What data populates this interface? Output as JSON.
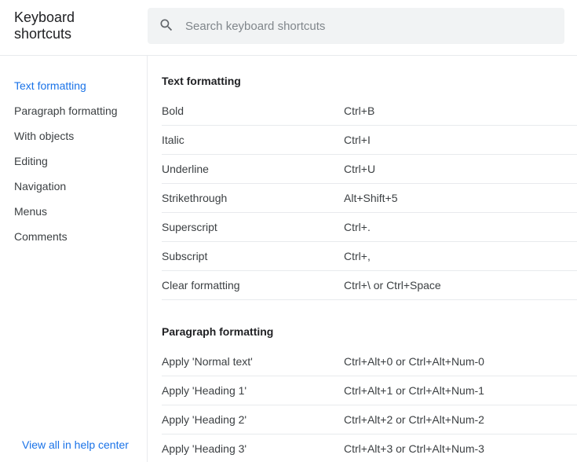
{
  "title": "Keyboard shortcuts",
  "search": {
    "placeholder": "Search keyboard shortcuts"
  },
  "sidebar": {
    "items": [
      {
        "label": "Text formatting",
        "active": true
      },
      {
        "label": "Paragraph formatting",
        "active": false
      },
      {
        "label": "With objects",
        "active": false
      },
      {
        "label": "Editing",
        "active": false
      },
      {
        "label": "Navigation",
        "active": false
      },
      {
        "label": "Menus",
        "active": false
      },
      {
        "label": "Comments",
        "active": false
      }
    ],
    "help_link": "View all in help center"
  },
  "sections": [
    {
      "title": "Text formatting",
      "rows": [
        {
          "label": "Bold",
          "keys": "Ctrl+B"
        },
        {
          "label": "Italic",
          "keys": "Ctrl+I"
        },
        {
          "label": "Underline",
          "keys": "Ctrl+U"
        },
        {
          "label": "Strikethrough",
          "keys": "Alt+Shift+5"
        },
        {
          "label": "Superscript",
          "keys": "Ctrl+."
        },
        {
          "label": "Subscript",
          "keys": "Ctrl+,"
        },
        {
          "label": "Clear formatting",
          "keys": "Ctrl+\\ or Ctrl+Space"
        }
      ]
    },
    {
      "title": "Paragraph formatting",
      "rows": [
        {
          "label": "Apply 'Normal text'",
          "keys": "Ctrl+Alt+0 or Ctrl+Alt+Num-0"
        },
        {
          "label": "Apply 'Heading 1'",
          "keys": "Ctrl+Alt+1 or Ctrl+Alt+Num-1"
        },
        {
          "label": "Apply 'Heading 2'",
          "keys": "Ctrl+Alt+2 or Ctrl+Alt+Num-2"
        },
        {
          "label": "Apply 'Heading 3'",
          "keys": "Ctrl+Alt+3 or Ctrl+Alt+Num-3"
        }
      ]
    }
  ]
}
